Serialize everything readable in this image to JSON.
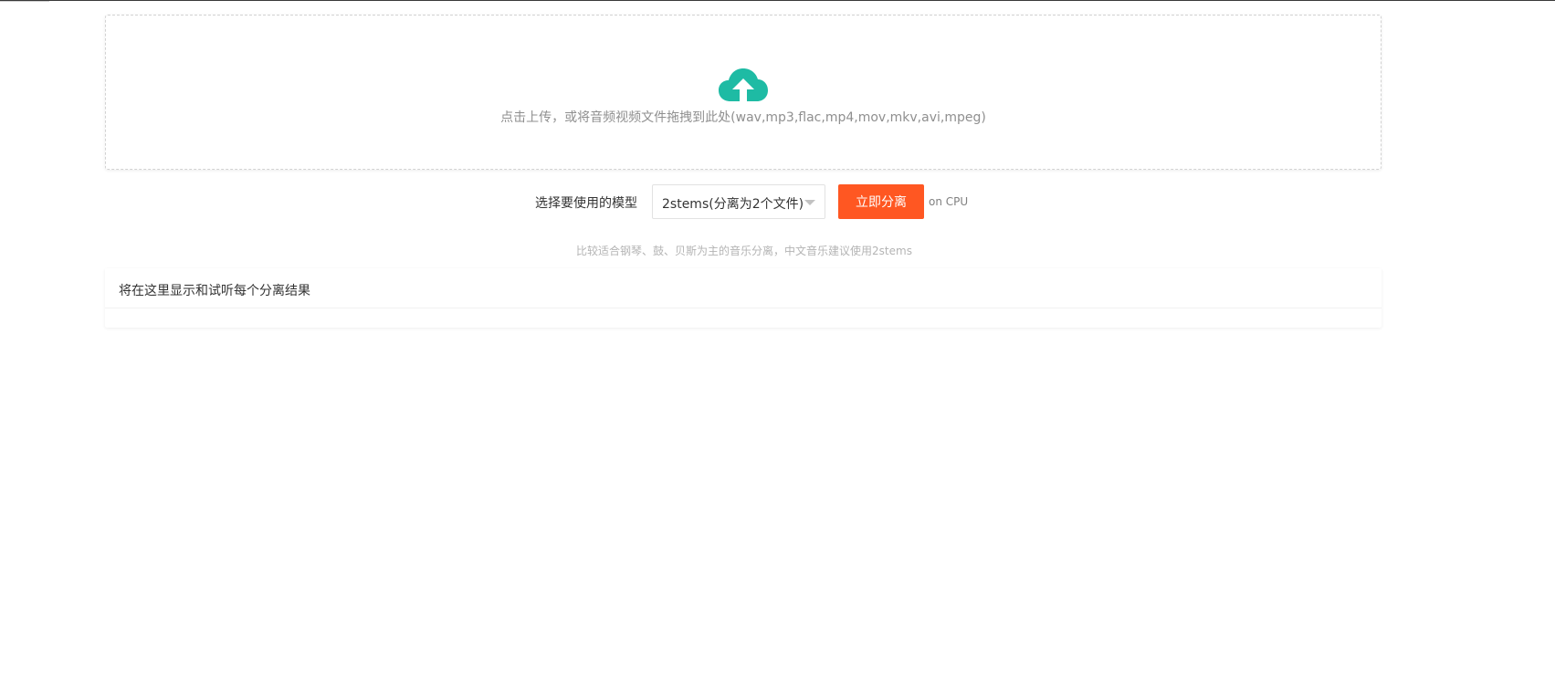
{
  "upload": {
    "icon": "cloud-upload-icon",
    "icon_color": "#1ebba4",
    "instruction_text": "点击上传，或将音频视频文件拖拽到此处(wav,mp3,flac,mp4,mov,mkv,avi,mpeg)"
  },
  "controls": {
    "model_label": "选择要使用的模型",
    "model_select": {
      "selected": "2stems(分离为2个文件)"
    },
    "separate_button_label": "立即分离",
    "separate_button_color": "#ff5722",
    "device_label": "on CPU"
  },
  "hint_text": "比较适合钢琴、鼓、贝斯为主的音乐分离，中文音乐建议使用2stems",
  "results": {
    "title": "将在这里显示和试听每个分离结果"
  }
}
